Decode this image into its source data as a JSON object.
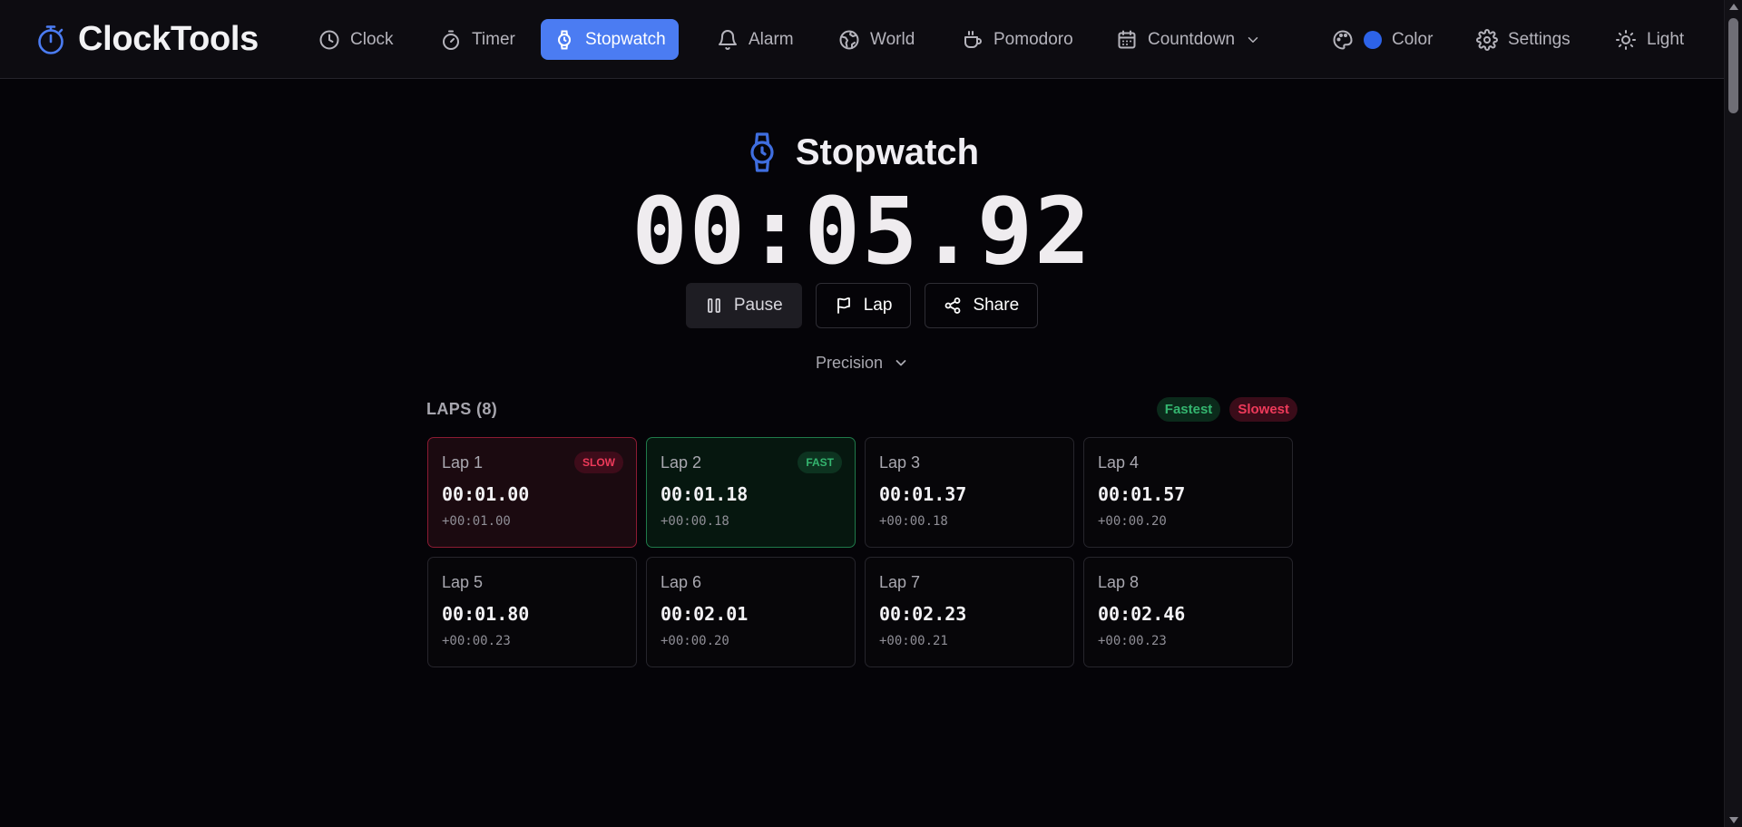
{
  "brand": {
    "name": "ClockTools",
    "icon": "stopwatch-icon",
    "accent": "#4b7cf2"
  },
  "nav": {
    "clock": "Clock",
    "timer": "Timer",
    "stopwatch": "Stopwatch",
    "alarm": "Alarm",
    "world": "World",
    "pomodoro": "Pomodoro",
    "countdown": "Countdown",
    "color": "Color",
    "settings": "Settings",
    "light": "Light",
    "color_swatch": "#2d63e8"
  },
  "stopwatch": {
    "title": "Stopwatch",
    "time": "00:05.92",
    "pause_label": "Pause",
    "lap_label": "Lap",
    "share_label": "Share",
    "precision_label": "Precision"
  },
  "laps": {
    "title": "LAPS (8)",
    "legend_fastest": "Fastest",
    "legend_slowest": "Slowest",
    "fast_badge": "FAST",
    "slow_badge": "SLOW",
    "colors": {
      "fast": "#34b56f",
      "slow": "#ee3a5a"
    },
    "items": [
      {
        "name": "Lap 1",
        "time": "00:01.00",
        "delta": "+00:01.00",
        "tag": "slow"
      },
      {
        "name": "Lap 2",
        "time": "00:01.18",
        "delta": "+00:00.18",
        "tag": "fast"
      },
      {
        "name": "Lap 3",
        "time": "00:01.37",
        "delta": "+00:00.18",
        "tag": ""
      },
      {
        "name": "Lap 4",
        "time": "00:01.57",
        "delta": "+00:00.20",
        "tag": ""
      },
      {
        "name": "Lap 5",
        "time": "00:01.80",
        "delta": "+00:00.23",
        "tag": ""
      },
      {
        "name": "Lap 6",
        "time": "00:02.01",
        "delta": "+00:00.20",
        "tag": ""
      },
      {
        "name": "Lap 7",
        "time": "00:02.23",
        "delta": "+00:00.21",
        "tag": ""
      },
      {
        "name": "Lap 8",
        "time": "00:02.46",
        "delta": "+00:00.23",
        "tag": ""
      }
    ]
  }
}
